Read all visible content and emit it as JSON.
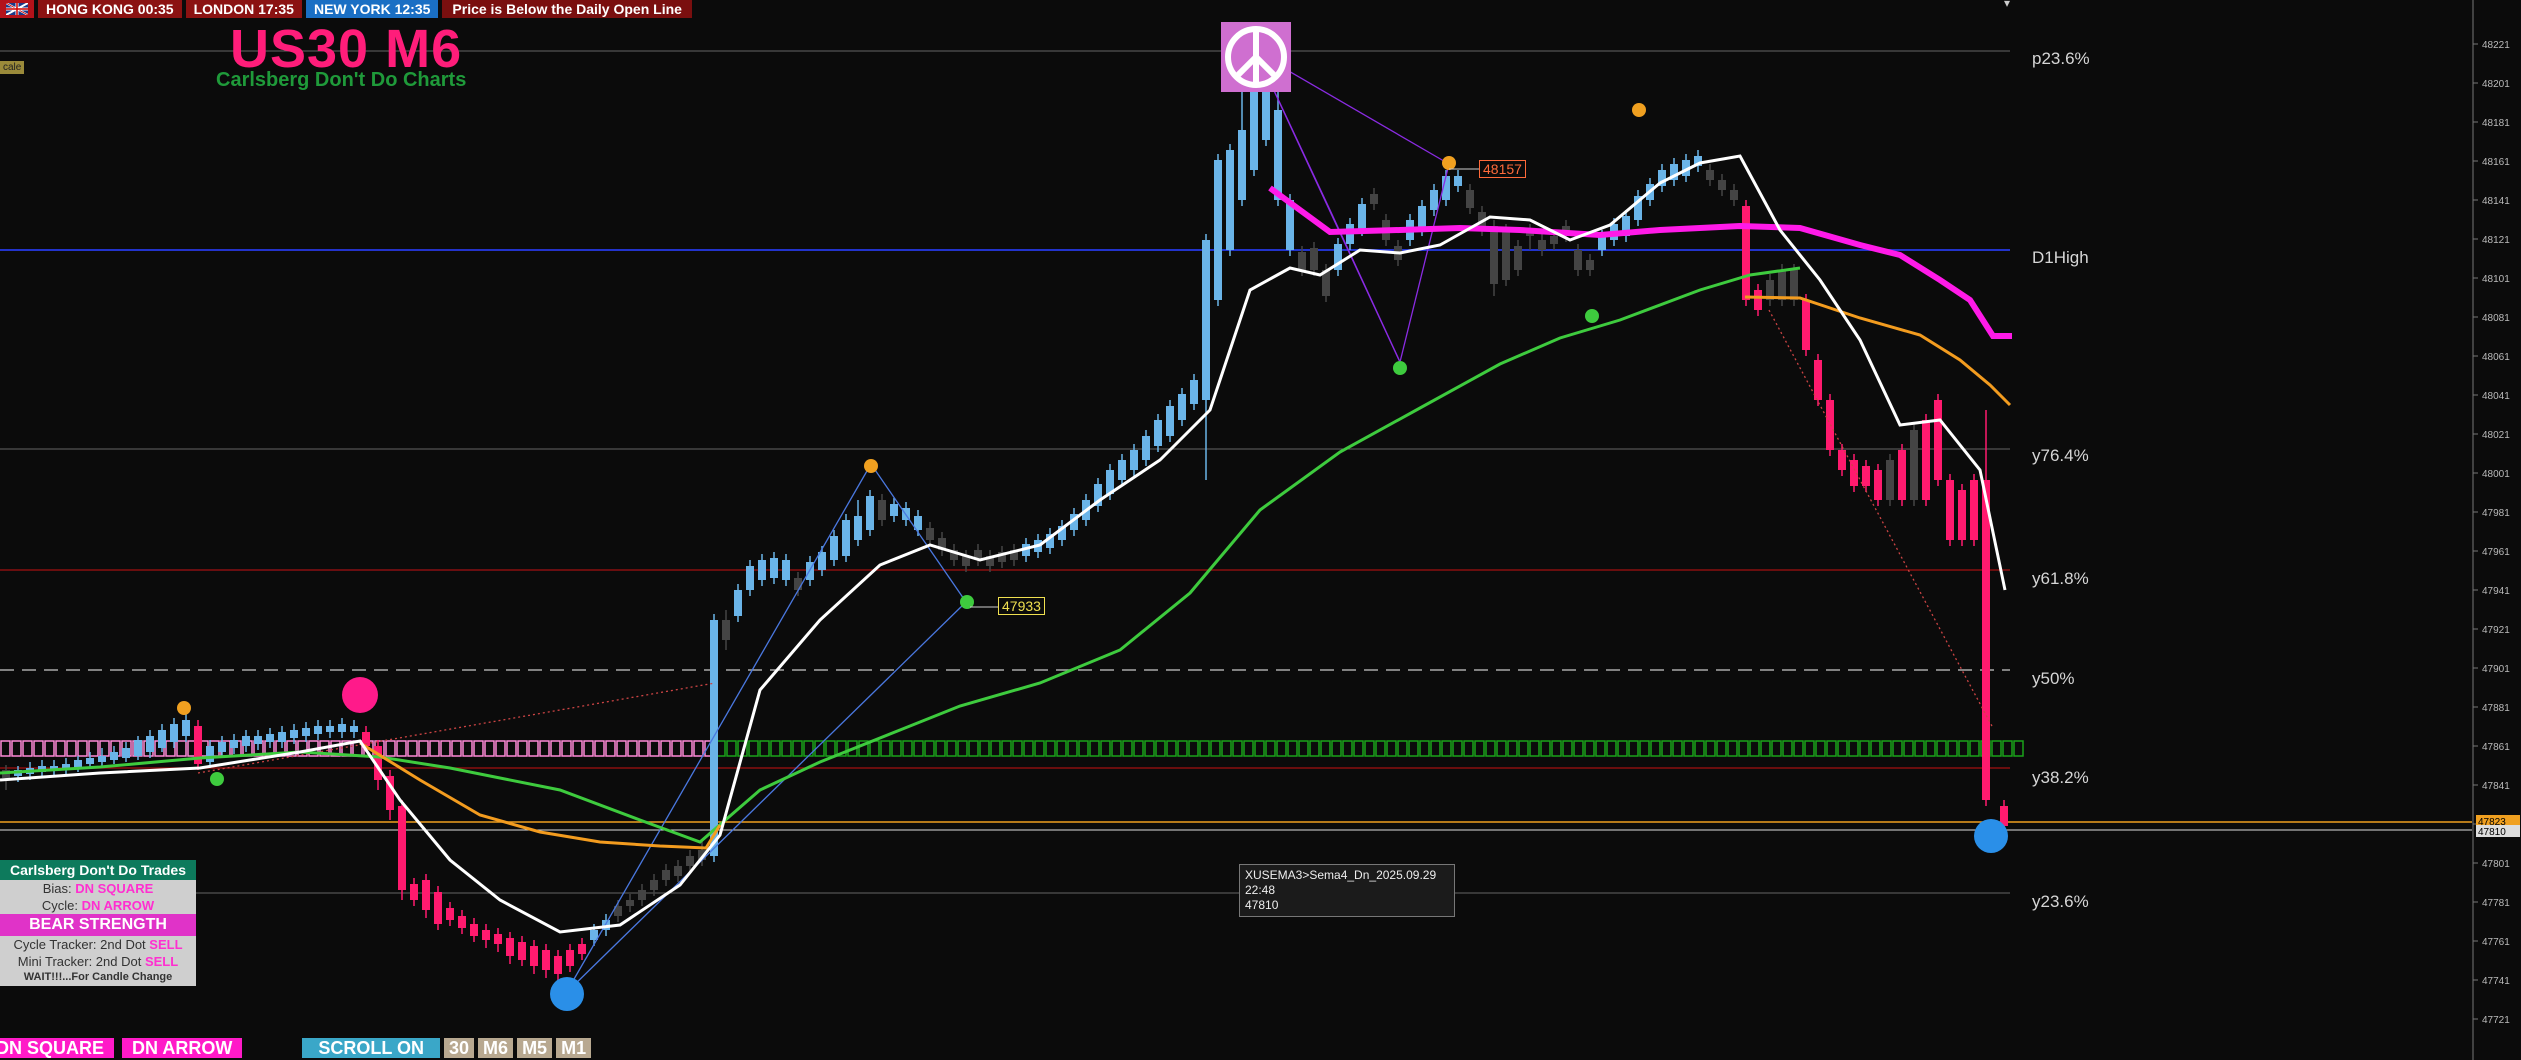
{
  "session_bar": {
    "hk_label": "HONG KONG 00:35",
    "london_label": "LONDON  17:35",
    "ny_label": "NEW YORK  12:35",
    "message": "Price is Below the Daily Open Line"
  },
  "title": "US30 M6",
  "subtitle": "Carlsberg Don't Do Charts",
  "scale_tag": "cale",
  "fib_labels": {
    "top": "p23.6%",
    "d1high": "D1High",
    "f764": "y76.4%",
    "f618": "y61.8%",
    "f50": "y50%",
    "f382": "y38.2%",
    "f236b": "y23.6%"
  },
  "price_tags": {
    "upper": "48157",
    "lower": "47933"
  },
  "tooltip": {
    "line1": "XUSEMA3>Sema4_Dn_2025.09.29 22:48",
    "line2": "47810"
  },
  "panel": {
    "header": "Carlsberg Don't Do Trades",
    "bias_label": "Bias:",
    "bias_value": "DN SQUARE",
    "cycle_label": "Cycle:",
    "cycle_value": "DN ARROW",
    "strength": "BEAR STRENGTH",
    "cycle_tracker_label": "Cycle Tracker: 2nd Dot",
    "cycle_tracker_value": "SELL",
    "mini_tracker_label": "Mini Tracker: 2nd Dot",
    "mini_tracker_value": "SELL",
    "warning": "WAIT!!!...For Candle Change"
  },
  "bottom_bar": {
    "dn_square": "DN SQUARE",
    "dn_arrow": "DN ARROW",
    "scroll": "SCROLL ON",
    "tf_30": "30",
    "tf_m6": "M6",
    "tf_m5": "M5",
    "tf_m1": "M1"
  },
  "price_axis": [
    "48221",
    "48201",
    "48181",
    "48161",
    "48141",
    "48121",
    "48101",
    "48081",
    "48061",
    "48041",
    "48021",
    "48001",
    "47981",
    "47961",
    "47941",
    "47921",
    "47901",
    "47881",
    "47861",
    "47841",
    "47821",
    "47801",
    "47781",
    "47761",
    "47741",
    "47721"
  ],
  "axis_current_price": "47823",
  "axis_bid_price": "47810",
  "colors": {
    "bull": "#6ab4e8",
    "bear": "#ff1a6e",
    "neutral": "#444444",
    "ema_fast": "#ffffff",
    "ema_slow": "#f39c1f",
    "ema_green": "#3ecb3e",
    "ema_magenta": "#ff1ae8"
  }
}
